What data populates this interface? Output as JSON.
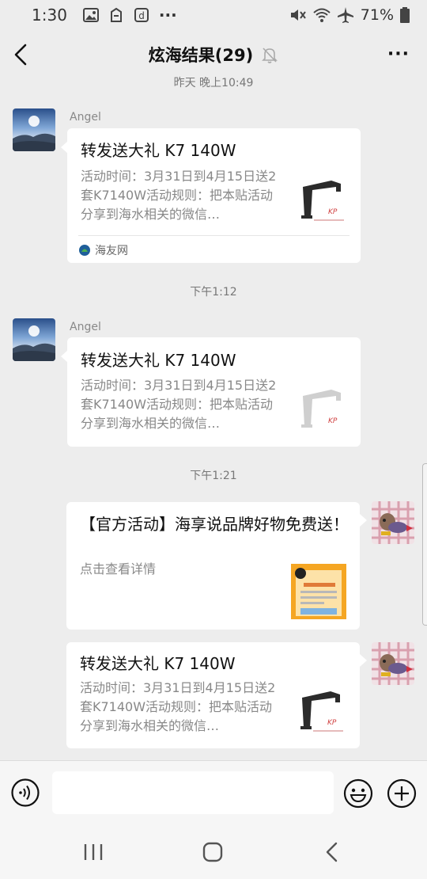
{
  "status": {
    "time": "1:30",
    "battery": "71%",
    "icons": [
      "image-icon",
      "clipboard-icon",
      "dict-icon",
      "more-dots-icon",
      "mute-icon",
      "wifi-icon",
      "airplane-icon",
      "battery-icon"
    ],
    "more_dots": "···"
  },
  "header": {
    "title": "炫海结果(29)",
    "back_icon": "chevron-left-icon",
    "mute_icon": "bell-muted-icon",
    "more_label": "···"
  },
  "messages": {
    "time1": "昨天 晚上10:49",
    "msg1": {
      "sender": "Angel",
      "title": "转发送大礼 K7 140W",
      "desc": "活动时间：3月31日到4月15日送2套K7140W活动规则：把本贴活动分享到海水相关的微信…",
      "source": "海友网"
    },
    "time2": "下午1:12",
    "msg2": {
      "sender": "Angel",
      "title": "转发送大礼 K7 140W",
      "desc": "活动时间：3月31日到4月15日送2套K7140W活动规则：把本贴活动分享到海水相关的微信…"
    },
    "time3": "下午1:21",
    "msg3": {
      "title": "【官方活动】海享说品牌好物免费送！",
      "desc": "点击查看详情"
    },
    "msg4": {
      "title": "转发送大礼 K7 140W",
      "desc": "活动时间：3月31日到4月15日送2套K7140W活动规则：把本贴活动分享到海水相关的微信…"
    }
  },
  "input": {
    "value": "",
    "voice_icon": "voice-icon",
    "emoji_icon": "emoji-icon",
    "plus_icon": "plus-circle-icon"
  },
  "system_nav": [
    "recents-icon",
    "home-icon",
    "back-icon"
  ],
  "colors": {
    "background": "#ededed",
    "card": "#ffffff",
    "meta_text": "#888888"
  }
}
